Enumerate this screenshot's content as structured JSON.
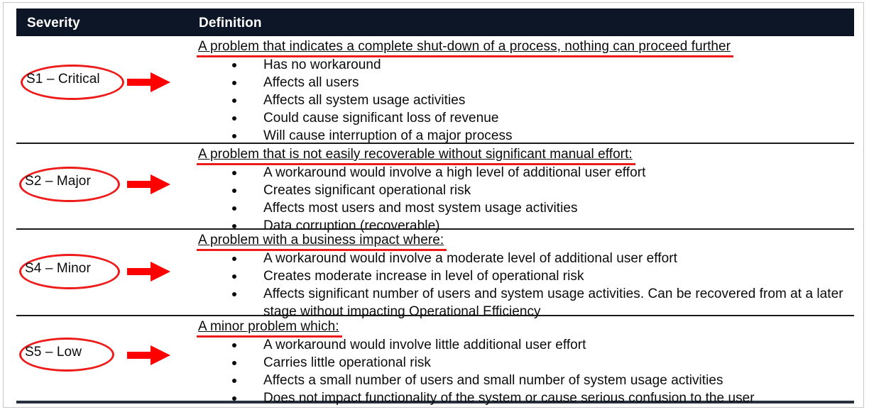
{
  "table": {
    "columns": {
      "severity": "Severity",
      "definition": "Definition"
    },
    "rows": [
      {
        "severity": "S1 – Critical",
        "heading": "A problem that indicates a complete shut-down of a process, nothing can proceed further",
        "bullets": [
          "Has no workaround",
          "Affects all users",
          "Affects all system usage activities",
          "Could cause significant loss of revenue",
          "Will cause interruption of a major process"
        ]
      },
      {
        "severity": "S2 – Major",
        "heading": "A problem that is not easily recoverable without significant manual effort:",
        "bullets": [
          "A workaround would involve a high level of additional user effort",
          "Creates significant operational risk",
          "Affects most users and most system usage activities",
          "Data corruption (recoverable)"
        ]
      },
      {
        "severity": "S4 – Minor",
        "heading": "A problem with a business impact where:",
        "bullets": [
          "A workaround would involve a moderate level of additional user effort",
          "Creates moderate increase in level of operational risk",
          "Affects significant number of users and system usage activities. Can be recovered from at a later stage without impacting Operational Efficiency"
        ]
      },
      {
        "severity": "S5 – Low",
        "heading": "A minor problem which:",
        "bullets": [
          "A workaround would involve little additional user effort",
          "Carries little operational risk",
          "Affects a small number of users and small number of system usage activities",
          "Does not impact functionality of the system or cause serious confusion to the user"
        ]
      }
    ]
  },
  "annotations": {
    "ellipse_color": "#ee1b1b",
    "arrow_color": "#ff0000",
    "underline_color": "#ee1b1b",
    "arrow_icon": "right-arrow-icon",
    "ellipse_icon": "ellipse-highlight-icon"
  },
  "colors": {
    "header_background": "#0d1626",
    "header_text": "#ffffff",
    "body_text": "#0b0b0b",
    "page_border": "#c7c7c7",
    "row_divider": "#1a1a1a"
  }
}
